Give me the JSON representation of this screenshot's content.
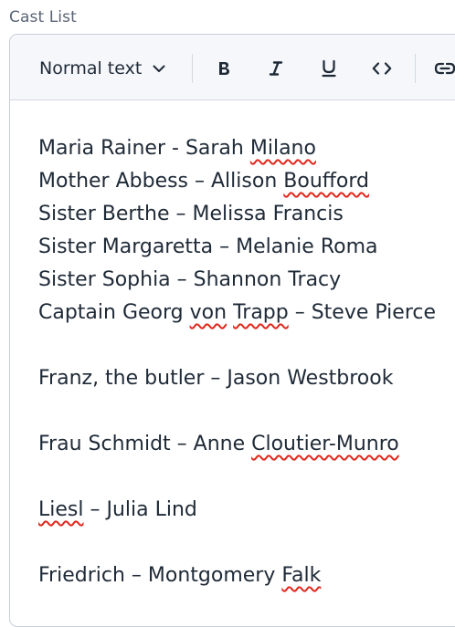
{
  "field": {
    "label": "Cast List"
  },
  "toolbar": {
    "block_format": "Normal text",
    "buttons": [
      {
        "name": "bold",
        "glyph": "B"
      },
      {
        "name": "italic",
        "glyph": "I"
      },
      {
        "name": "underline",
        "glyph": "U"
      },
      {
        "name": "code",
        "glyph": "<>"
      },
      {
        "name": "link",
        "glyph": "link"
      }
    ]
  },
  "content": {
    "lines": [
      {
        "segments": [
          {
            "text": "Maria Rainer - Sarah "
          },
          {
            "text": "Milano",
            "misspelled": true
          }
        ]
      },
      {
        "segments": [
          {
            "text": "Mother Abbess – Allison "
          },
          {
            "text": "Boufford",
            "misspelled": true
          }
        ]
      },
      {
        "segments": [
          {
            "text": "Sister Berthe – Melissa Francis"
          }
        ]
      },
      {
        "segments": [
          {
            "text": "Sister Margaretta –  Melanie Roma"
          }
        ]
      },
      {
        "segments": [
          {
            "text": "Sister Sophia – Shannon Tracy"
          }
        ]
      },
      {
        "segments": [
          {
            "text": "Captain Georg "
          },
          {
            "text": "von",
            "misspelled": true
          },
          {
            "text": " "
          },
          {
            "text": "Trapp",
            "misspelled": true
          },
          {
            "text": " – Steve Pierce"
          }
        ]
      },
      {
        "segments": []
      },
      {
        "segments": [
          {
            "text": "Franz, the butler – Jason Westbrook"
          }
        ]
      },
      {
        "segments": []
      },
      {
        "segments": [
          {
            "text": "Frau Schmidt – Anne "
          },
          {
            "text": "Cloutier-Munro",
            "misspelled": true
          }
        ]
      },
      {
        "segments": []
      },
      {
        "segments": [
          {
            "text": "Liesl",
            "misspelled": true
          },
          {
            "text": " – Julia Lind"
          }
        ]
      },
      {
        "segments": []
      },
      {
        "segments": [
          {
            "text": "Friedrich – Montgomery "
          },
          {
            "text": "Falk",
            "misspelled": true
          }
        ]
      }
    ]
  },
  "colors": {
    "text": "#1f2a37",
    "label": "#5a6474",
    "toolbar_bg": "#f5f7fa",
    "border": "#c7cfd9",
    "spellcheck": "#e0281d"
  }
}
